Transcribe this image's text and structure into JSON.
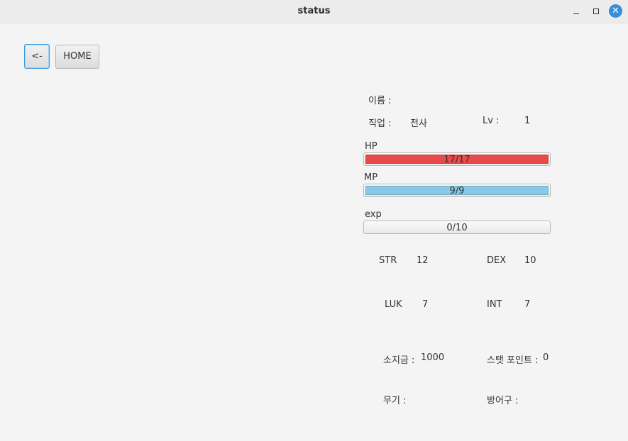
{
  "window": {
    "title": "status",
    "close_glyph": "✕"
  },
  "nav": {
    "back_label": "<-",
    "home_label": "HOME"
  },
  "profile": {
    "name_label": "이름 :",
    "name_value": "",
    "job_label": "직업 :",
    "job_value": "전사",
    "level_label": "Lv :",
    "level_value": "1"
  },
  "bars": {
    "hp": {
      "label": "HP",
      "text": "17/17",
      "fraction": 1.0,
      "color": "#e84a4a"
    },
    "mp": {
      "label": "MP",
      "text": "9/9",
      "fraction": 1.0,
      "color": "#87c9e6"
    },
    "exp": {
      "label": "exp",
      "text": "0/10",
      "fraction": 0.0,
      "color": "#87c9e6"
    }
  },
  "stats": {
    "str_label": "STR",
    "str_value": "12",
    "dex_label": "DEX",
    "dex_value": "10",
    "luk_label": "LUK",
    "luk_value": "7",
    "int_label": "INT",
    "int_value": "7"
  },
  "extra": {
    "gold_label": "소지금 :",
    "gold_value": "1000",
    "stat_points_label": "스탯 포인트 :",
    "stat_points_value": "0",
    "weapon_label": "무기 :",
    "weapon_value": "",
    "armor_label": "방어구 :",
    "armor_value": ""
  }
}
